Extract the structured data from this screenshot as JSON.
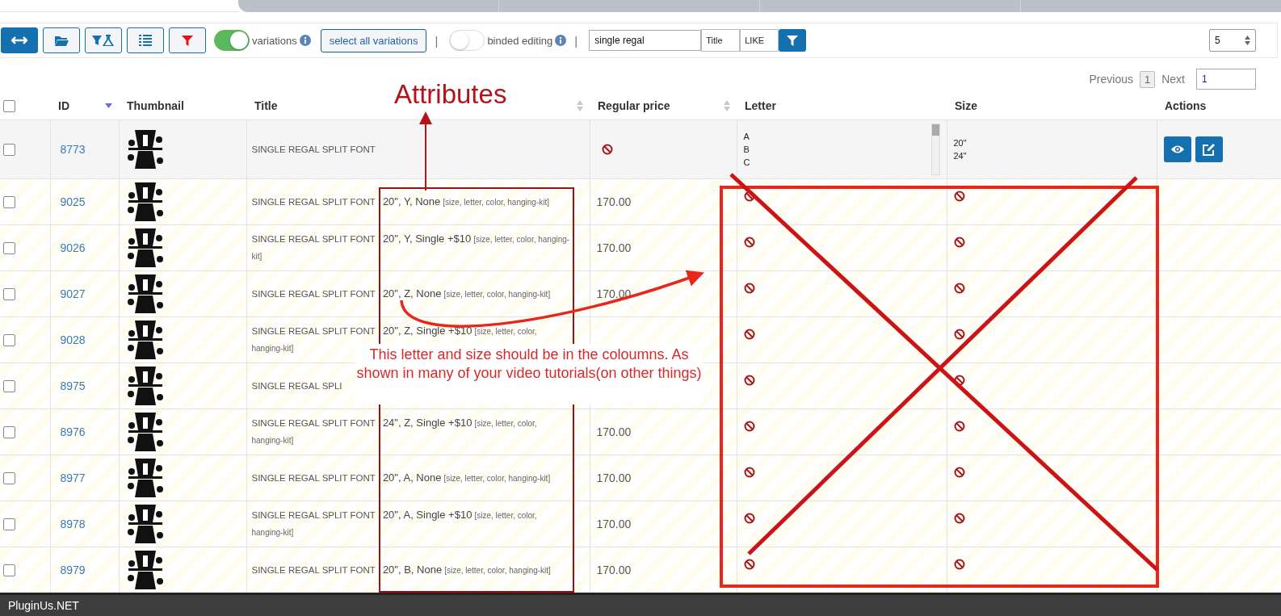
{
  "tabs": [
    {
      "selected": true
    },
    {
      "selected": false
    },
    {
      "selected": false
    },
    {
      "selected": false
    },
    {
      "selected": false
    }
  ],
  "toolbar": {
    "icon_buttons": [
      {
        "kind": "swap",
        "selected": true
      },
      {
        "kind": "folder",
        "selected": false
      },
      {
        "kind": "filter-flask",
        "selected": false
      },
      {
        "kind": "list",
        "selected": false
      },
      {
        "kind": "funnel",
        "selected": false
      }
    ],
    "items": [
      {
        "kind": "toggle",
        "label": "variations",
        "on": true
      },
      {
        "kind": "button",
        "label": "select all variations"
      },
      {
        "kind": "separator",
        "text": "|"
      },
      {
        "kind": "toggle",
        "label": "binded editing",
        "on": false
      },
      {
        "kind": "separator",
        "text": "|"
      },
      {
        "kind": "search",
        "value": "single regal"
      },
      {
        "kind": "select",
        "value": "Title"
      },
      {
        "kind": "select",
        "value": "LIKE"
      },
      {
        "kind": "filter"
      }
    ],
    "per_page": "5"
  },
  "pagination": {
    "previous": "Previous",
    "page": "1",
    "next": "Next",
    "goto": "1"
  },
  "table": {
    "columns": [
      {
        "kind": "check",
        "checked": false
      },
      {
        "label": "ID",
        "sorted_desc": true
      },
      {
        "label": "Thumbnail"
      },
      {
        "label": "Title",
        "sortable": true
      },
      {
        "label": "Regular price",
        "sortable": true
      },
      {
        "label": "Letter"
      },
      {
        "label": "Size"
      },
      {
        "label": "Actions"
      }
    ],
    "rows": [
      {
        "kind": "parent",
        "checked": false,
        "id": "8773",
        "title": "SINGLE REGAL SPLIT FONT",
        "price": {
          "kind": "empty"
        },
        "letter": {
          "kind": "list",
          "values": [
            "A",
            "B",
            "C"
          ]
        },
        "size": {
          "kind": "list",
          "values": [
            "20\"",
            "24\""
          ]
        },
        "actions": [
          {
            "kind": "view"
          },
          {
            "kind": "edit"
          }
        ]
      },
      {
        "kind": "variation",
        "checked": false,
        "id": "9025",
        "title": "SINGLE REGAL SPLIT FONT",
        "attributes": "20\", Y, None",
        "attribute_names": "[size, letter, color, hanging-kit]",
        "price": {
          "kind": "value",
          "text": "170.00"
        },
        "letter": {
          "kind": "empty"
        },
        "size": {
          "kind": "empty"
        }
      },
      {
        "kind": "variation",
        "checked": false,
        "id": "9026",
        "title": "SINGLE REGAL SPLIT FONT",
        "attributes": "20\", Y, Single +$10",
        "attribute_names": "[size, letter, color, hanging-kit]",
        "price": {
          "kind": "value",
          "text": "170.00"
        },
        "letter": {
          "kind": "empty"
        },
        "size": {
          "kind": "empty"
        }
      },
      {
        "kind": "variation",
        "checked": false,
        "id": "9027",
        "title": "SINGLE REGAL SPLIT FONT",
        "attributes": "20\", Z, None",
        "attribute_names": "[size, letter, color, hanging-kit]",
        "price": {
          "kind": "value",
          "text": "170.00"
        },
        "letter": {
          "kind": "empty"
        },
        "size": {
          "kind": "empty"
        }
      },
      {
        "kind": "variation",
        "checked": false,
        "id": "9028",
        "title": "SINGLE REGAL SPLIT FONT",
        "attributes": "20\", Z, Single +$10",
        "attribute_names": "[size, letter, color, hanging-kit]",
        "letter": {
          "kind": "empty"
        },
        "size": {
          "kind": "empty"
        }
      },
      {
        "kind": "variation",
        "checked": false,
        "id": "8975",
        "title": "SINGLE REGAL SPLI",
        "letter": {
          "kind": "empty"
        },
        "size": {
          "kind": "empty"
        }
      },
      {
        "kind": "variation",
        "checked": false,
        "id": "8976",
        "title": "SINGLE REGAL SPLIT FONT",
        "attributes": "24\", Z, Single +$10",
        "attribute_names": "[size, letter, color, hanging-kit]",
        "price": {
          "kind": "value",
          "text": "170.00"
        },
        "letter": {
          "kind": "empty"
        },
        "size": {
          "kind": "empty"
        }
      },
      {
        "kind": "variation",
        "checked": false,
        "id": "8977",
        "title": "SINGLE REGAL SPLIT FONT",
        "attributes": "20\", A, None",
        "attribute_names": "[size, letter, color, hanging-kit]",
        "price": {
          "kind": "value",
          "text": "170.00"
        },
        "letter": {
          "kind": "empty"
        },
        "size": {
          "kind": "empty"
        }
      },
      {
        "kind": "variation",
        "checked": false,
        "id": "8978",
        "title": "SINGLE REGAL SPLIT FONT",
        "attributes": "20\", A, Single +$10",
        "attribute_names": "[size, letter, color, hanging-kit]",
        "price": {
          "kind": "value",
          "text": "170.00"
        },
        "letter": {
          "kind": "empty"
        },
        "size": {
          "kind": "empty"
        }
      },
      {
        "kind": "variation",
        "checked": false,
        "id": "8979",
        "title": "SINGLE REGAL SPLIT FONT",
        "attributes": "20\", B, None",
        "attribute_names": "[size, letter, color, hanging-kit]",
        "price": {
          "kind": "value",
          "text": "170.00"
        },
        "letter": {
          "kind": "empty"
        },
        "size": {
          "kind": "empty"
        }
      }
    ]
  },
  "annotations": {
    "label": "Attributes",
    "note": "This letter and size should be in the coloumns. As shown in many of your video tutorials(on other things)"
  },
  "footer": {
    "text": "PluginUs.NET"
  }
}
